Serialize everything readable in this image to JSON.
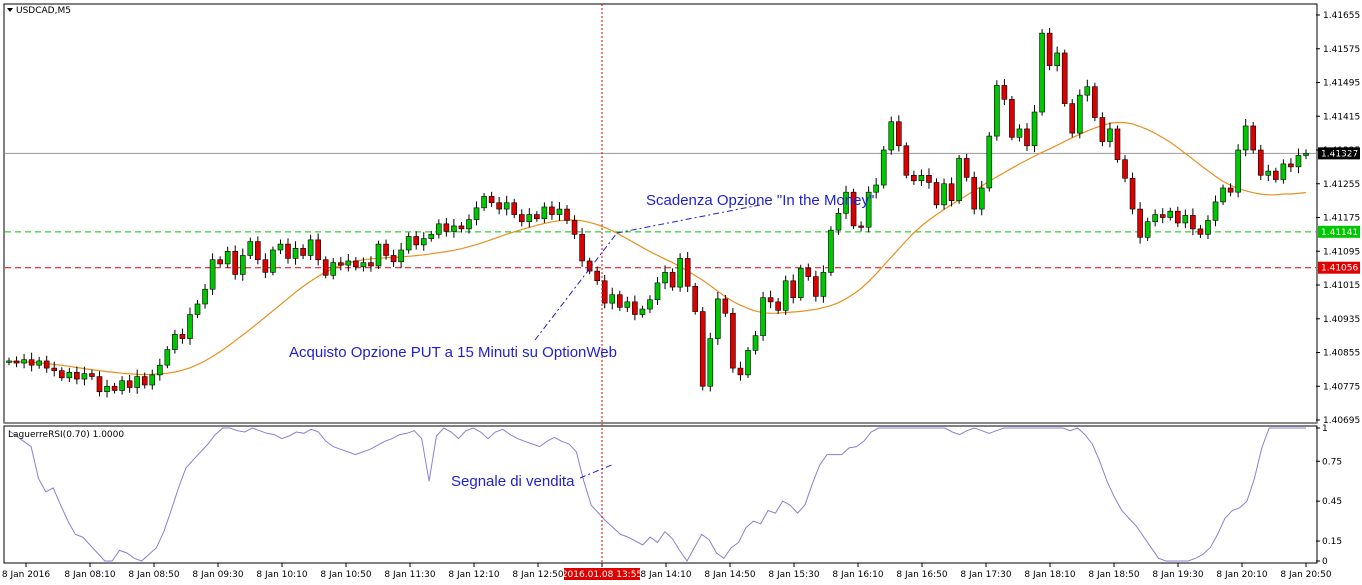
{
  "window": {
    "symbol_label": "USDCAD,M5",
    "indicator_label": "LaguerreRSI(0.70) 1.0000"
  },
  "colors": {
    "bull": "#00c800",
    "bear": "#dc0000",
    "ma": "#e8901e",
    "rsi": "#8a7fd6",
    "green_level": "#00c800",
    "red_level": "#e00000",
    "annotation": "#1f1fd0"
  },
  "chart_data": [
    {
      "type": "candlestick",
      "title": "USDCAD,M5",
      "ylim": [
        1.40695,
        1.41655
      ],
      "y_ticks": [
        "1.41655",
        "1.41575",
        "1.41495",
        "1.41415",
        "1.41335",
        "1.41255",
        "1.41175",
        "1.41095",
        "1.41015",
        "1.40935",
        "1.40855",
        "1.40775",
        "1.40695"
      ],
      "x_ticks": [
        "8 Jan 2016",
        "8 Jan 08:10",
        "8 Jan 08:50",
        "8 Jan 09:30",
        "8 Jan 10:10",
        "8 Jan 10:50",
        "8 Jan 11:30",
        "8 Jan 12:10",
        "8 Jan 12:50",
        "2016.01.08 13:55",
        "8 Jan 14:10",
        "8 Jan 14:50",
        "8 Jan 15:30",
        "8 Jan 16:10",
        "8 Jan 16:50",
        "8 Jan 17:30",
        "8 Jan 18:10",
        "8 Jan 18:50",
        "8 Jan 19:30",
        "8 Jan 20:10",
        "8 Jan 20:50"
      ],
      "current_time_marker": "2016.01.08 13:55",
      "levels": [
        {
          "name": "current",
          "value": 1.41327,
          "label": "1.41327"
        },
        {
          "name": "green",
          "value": 1.41141,
          "label": "1.41141"
        },
        {
          "name": "red",
          "value": 1.41056,
          "label": "1.41056"
        }
      ],
      "closes": [
        1.40835,
        1.4083,
        1.40838,
        1.40825,
        1.40835,
        1.40818,
        1.40812,
        1.40795,
        1.40808,
        1.40792,
        1.40805,
        1.40798,
        1.40762,
        1.40775,
        1.40765,
        1.40788,
        1.40772,
        1.40798,
        1.40778,
        1.40802,
        1.40825,
        1.40862,
        1.40898,
        1.40888,
        1.40945,
        1.4097,
        1.41005,
        1.41075,
        1.41065,
        1.41095,
        1.4104,
        1.41085,
        1.41118,
        1.41075,
        1.41045,
        1.41098,
        1.41112,
        1.41078,
        1.41102,
        1.41085,
        1.41122,
        1.41075,
        1.41038,
        1.41068,
        1.41062,
        1.41072,
        1.41058,
        1.41068,
        1.4106,
        1.41112,
        1.41085,
        1.4107,
        1.41098,
        1.4113,
        1.4111,
        1.41125,
        1.41135,
        1.4116,
        1.41142,
        1.41155,
        1.41148,
        1.4117,
        1.41198,
        1.41225,
        1.4121,
        1.41195,
        1.4121,
        1.41182,
        1.41165,
        1.41182,
        1.41172,
        1.412,
        1.41182,
        1.41195,
        1.41168,
        1.41135,
        1.41072,
        1.41048,
        1.41025,
        1.40972,
        1.40992,
        1.40962,
        1.40975,
        1.40945,
        1.40958,
        1.4098,
        1.4102,
        1.41045,
        1.4101,
        1.41078,
        1.41012,
        1.40952,
        1.40775,
        1.40888,
        1.40982,
        1.40948,
        1.40818,
        1.40802,
        1.4086,
        1.40895,
        1.40985,
        1.40975,
        1.40955,
        1.41025,
        1.40985,
        1.41055,
        1.41035,
        1.40988,
        1.41045,
        1.41145,
        1.41185,
        1.41235,
        1.41155,
        1.41152,
        1.41235,
        1.41252,
        1.41335,
        1.41402,
        1.41345,
        1.41275,
        1.41262,
        1.41275,
        1.41258,
        1.41205,
        1.41255,
        1.41215,
        1.41315,
        1.4127,
        1.41195,
        1.41245,
        1.41368,
        1.41488,
        1.41455,
        1.41365,
        1.41385,
        1.41345,
        1.41425,
        1.41612,
        1.41535,
        1.41565,
        1.41445,
        1.41375,
        1.41465,
        1.41485,
        1.41412,
        1.41355,
        1.41385,
        1.41312,
        1.41268,
        1.41195,
        1.41128,
        1.41165,
        1.41182,
        1.41175,
        1.4119,
        1.41162,
        1.4118,
        1.41148,
        1.41135,
        1.41168,
        1.41212,
        1.41245,
        1.41235,
        1.41335,
        1.41392,
        1.41335,
        1.41275,
        1.41285,
        1.41265,
        1.41302,
        1.41295,
        1.41322,
        1.41327
      ],
      "ma_period": 21
    },
    {
      "type": "line",
      "title": "LaguerreRSI(0.70) 1.0000",
      "ylim": [
        0,
        1
      ],
      "y_ticks": [
        "1",
        "0.75",
        "0.45",
        "0.15",
        "0"
      ],
      "values": [
        0.98,
        0.94,
        0.9,
        0.86,
        0.62,
        0.52,
        0.55,
        0.42,
        0.3,
        0.2,
        0.18,
        0.12,
        0.06,
        0.0,
        0.0,
        0.08,
        0.06,
        0.02,
        0.0,
        0.05,
        0.1,
        0.22,
        0.38,
        0.55,
        0.7,
        0.76,
        0.82,
        0.88,
        0.95,
        1.0,
        1.0,
        0.98,
        0.97,
        1.0,
        0.98,
        0.96,
        0.95,
        0.92,
        0.94,
        0.97,
        0.96,
        0.99,
        0.97,
        0.9,
        0.86,
        0.84,
        0.82,
        0.8,
        0.82,
        0.84,
        0.87,
        0.9,
        0.92,
        0.95,
        0.96,
        0.98,
        0.92,
        0.6,
        0.94,
        1.0,
        0.97,
        0.92,
        0.98,
        1.0,
        0.97,
        0.92,
        0.97,
        0.99,
        0.95,
        0.92,
        0.9,
        0.88,
        0.86,
        0.9,
        0.93,
        0.9,
        0.88,
        0.82,
        0.6,
        0.42,
        0.36,
        0.3,
        0.25,
        0.2,
        0.18,
        0.15,
        0.12,
        0.18,
        0.14,
        0.22,
        0.17,
        0.08,
        0.0,
        0.1,
        0.2,
        0.16,
        0.06,
        0.02,
        0.1,
        0.14,
        0.25,
        0.3,
        0.28,
        0.38,
        0.36,
        0.45,
        0.42,
        0.36,
        0.42,
        0.58,
        0.72,
        0.8,
        0.8,
        0.8,
        0.85,
        0.86,
        0.9,
        0.97,
        1.0,
        1.0,
        1.0,
        1.0,
        1.0,
        1.0,
        1.0,
        1.0,
        1.0,
        1.0,
        0.97,
        0.95,
        0.98,
        1.0,
        0.98,
        0.96,
        0.98,
        1.0,
        1.0,
        1.0,
        1.0,
        1.0,
        1.0,
        1.0,
        1.0,
        1.0,
        0.98,
        1.0,
        0.95,
        0.88,
        0.75,
        0.6,
        0.48,
        0.38,
        0.32,
        0.26,
        0.18,
        0.1,
        0.02,
        0.0,
        0.0,
        0.0,
        0.0,
        0.02,
        0.05,
        0.1,
        0.2,
        0.32,
        0.38,
        0.4,
        0.45,
        0.62,
        0.85,
        1.0,
        1.0,
        1.0,
        1.0,
        1.0,
        1.0
      ]
    }
  ],
  "annotations": {
    "expiry": "Scadenza Opzione \"In the Money\"",
    "purchase": "Acquisto Opzione PUT a 15 Minuti su OptionWeb",
    "sell_signal": "Segnale di vendita"
  }
}
